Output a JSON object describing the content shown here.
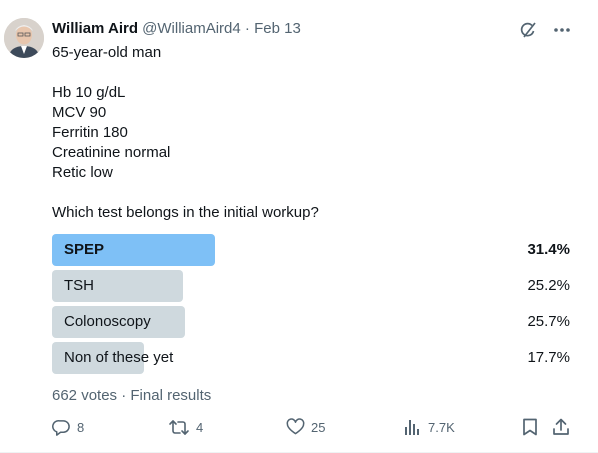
{
  "author": {
    "name": "William Aird",
    "handle": "@WilliamAird4",
    "separator": "·",
    "date": "Feb 13"
  },
  "tweet_lines": [
    "65-year-old man",
    "",
    "Hb 10 g/dL",
    "MCV 90",
    "Ferritin 180",
    "Creatinine normal",
    "Retic low",
    "",
    "Which test belongs in the initial workup?"
  ],
  "poll": {
    "options": [
      {
        "label": "SPEP",
        "percent_text": "31.4%",
        "percent": 31.4,
        "winner": true
      },
      {
        "label": "TSH",
        "percent_text": "25.2%",
        "percent": 25.2,
        "winner": false
      },
      {
        "label": "Colonoscopy",
        "percent_text": "25.7%",
        "percent": 25.7,
        "winner": false
      },
      {
        "label": "Non of these yet",
        "percent_text": "17.7%",
        "percent": 17.7,
        "winner": false
      }
    ],
    "votes": "662 votes",
    "separator": "·",
    "status": "Final results"
  },
  "actions": {
    "replies": "8",
    "reposts": "4",
    "likes": "25",
    "views": "7.7K"
  },
  "icons": [
    "grok-icon",
    "more-icon",
    "reply-icon",
    "repost-icon",
    "like-icon",
    "views-icon",
    "bookmark-icon",
    "share-icon"
  ],
  "colors": {
    "winner_bar": "#7ec0f6",
    "bar": "#cfd9de",
    "muted": "#536471"
  }
}
